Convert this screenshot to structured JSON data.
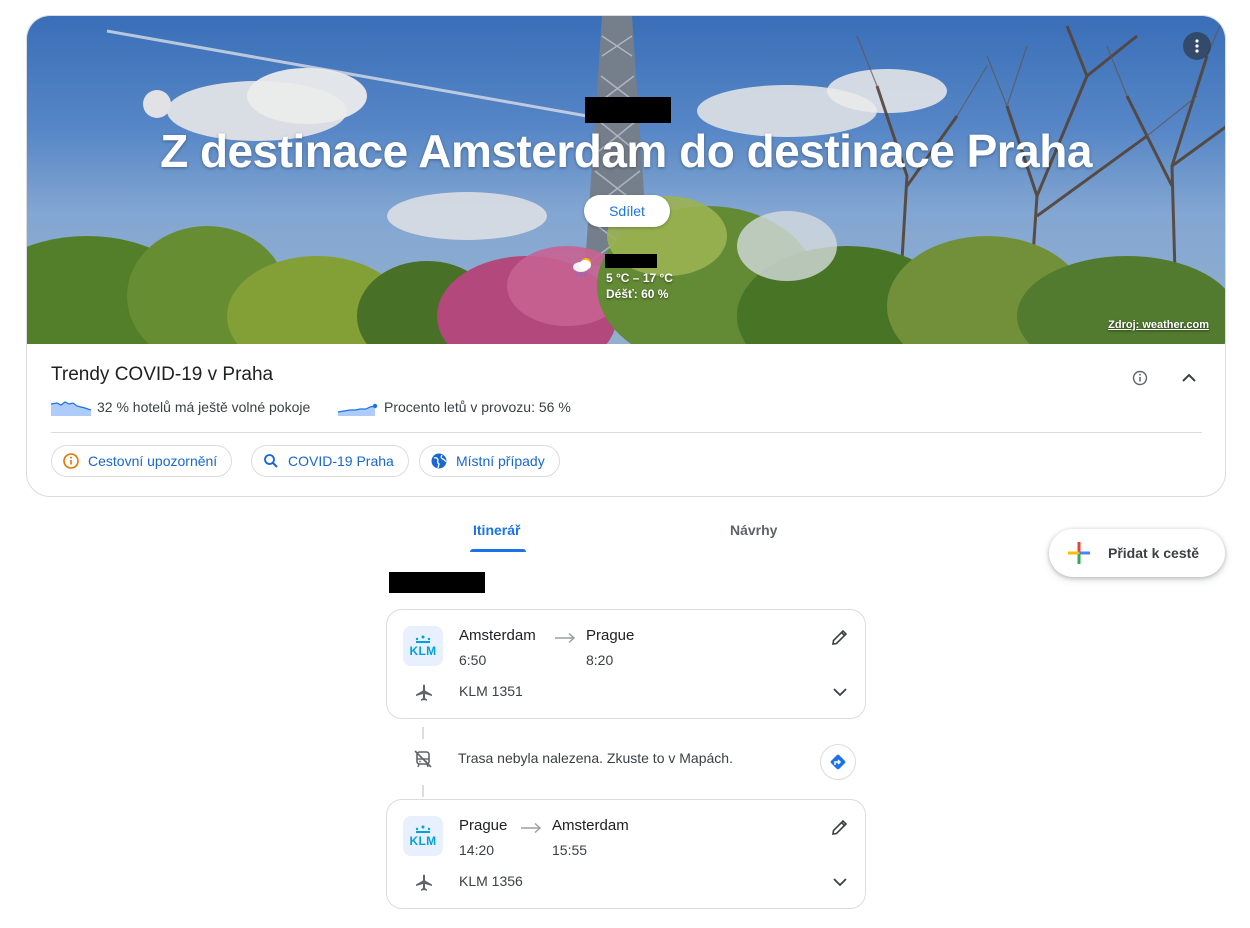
{
  "hero": {
    "title": "Z destinace Amsterdam do destinace Praha",
    "share_label": "Sdílet",
    "weather": {
      "icon": "rain-cloud-icon",
      "temperature": "5 °C – 17 °C",
      "rain": "Déšť: 60 %",
      "source": "Zdroj: weather.com"
    }
  },
  "covid": {
    "title": "Trendy COVID-19 v Praha",
    "trends": [
      {
        "text": "32 % hotelů má ještě volné pokoje",
        "value_percent": 32
      },
      {
        "text": "Procento letů v provozu: 56 %",
        "value_percent": 56
      }
    ],
    "chips": [
      {
        "label": "Cestovní upozornění",
        "icon": "info-icon"
      },
      {
        "label": "COVID-19 Praha",
        "icon": "search-icon"
      },
      {
        "label": "Místní případy",
        "icon": "globe-icon"
      }
    ]
  },
  "tabs": [
    {
      "label": "Itinerář",
      "active": true
    },
    {
      "label": "Návrhy",
      "active": false
    }
  ],
  "add_trip_label": "Přidat k cestě",
  "flights": [
    {
      "airline_logo": "KLM",
      "from": "Amsterdam",
      "to": "Prague",
      "depart": "6:50",
      "arrive": "8:20",
      "flight_number": "KLM 1351"
    },
    {
      "airline_logo": "KLM",
      "from": "Prague",
      "to": "Amsterdam",
      "depart": "14:20",
      "arrive": "15:55",
      "flight_number": "KLM 1356"
    }
  ],
  "route_message": "Trasa nebyla nalezena. Zkuste to v Mapách.",
  "colors": {
    "accent": "#1a73e8",
    "warning": "#e37400",
    "klm": "#00a1de"
  }
}
